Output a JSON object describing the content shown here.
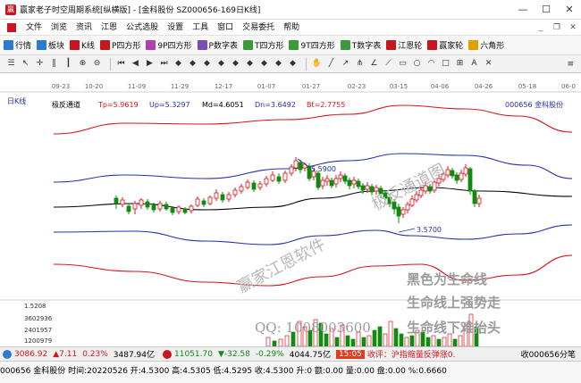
{
  "window": {
    "title": "赢家老子时空周期系统[纵横版] - [金科股份  SZ000656-169日K线]"
  },
  "menu": {
    "items": [
      "文件",
      "浏览",
      "资讯",
      "江恩",
      "公式选股",
      "设置",
      "工具",
      "窗口",
      "交易委托",
      "帮助"
    ]
  },
  "toolbar1": {
    "items": [
      {
        "label": "行情",
        "color": "#2a7ad2"
      },
      {
        "label": "板块",
        "color": "#2a7ad2"
      },
      {
        "label": "K线",
        "color": "#c8161d"
      },
      {
        "label": "P四方形",
        "color": "#c8161d"
      },
      {
        "label": "9P四方形",
        "color": "#b040b0"
      },
      {
        "label": "P数字表",
        "color": "#7a4fb5"
      },
      {
        "label": "T四方形",
        "color": "#3b9a3b"
      },
      {
        "label": "9T四方形",
        "color": "#3b9a3b"
      },
      {
        "label": "T数字表",
        "color": "#3b9a3b"
      },
      {
        "label": "江恩轮",
        "color": "#c8161d"
      },
      {
        "label": "赢家轮",
        "color": "#c8161d"
      },
      {
        "label": "六角形",
        "color": "#e0a000"
      }
    ]
  },
  "toolbar2": {
    "right_icon": "≡"
  },
  "chart": {
    "period": "日K线",
    "indicator_name": "极反通道",
    "tp_label": "Tp=5.9619",
    "up_label": "Up=5.3297",
    "md_label": "Md=4.6051",
    "dn_label": "Dn=3.6492",
    "bt_label": "Bt=2.7755",
    "stock_label": "000656 金科股份",
    "dates": [
      "09-23",
      "10-20",
      "11-09",
      "11-29",
      "12-17",
      "01-07",
      "01-27",
      "02-23",
      "03-15",
      "04-06",
      "04-26",
      "05-18",
      "06-0"
    ],
    "high_label": "5.5900",
    "low_label": "3.5700",
    "vol_ticks": [
      "1.5208",
      "3602936",
      "2401957",
      "1200979"
    ],
    "watermark1": "赢家江恩软件",
    "watermark2": "极反通道图",
    "slogan1": "黑色为生命线",
    "slogan2": "生命线上强势走",
    "slogan3": "生命线下难抬头",
    "qq": "QQ: 1008003600"
  },
  "status1": {
    "sh_index": "3086.92",
    "sh_change": "▲7.11",
    "sh_pct": "0.23%",
    "sh_amount": "3487.94亿",
    "sz_index": "11051.70",
    "sz_change": "▼-32.58",
    "sz_pct": "-0.29%",
    "sz_amount": "4044.75亿",
    "time_badge": "15:05",
    "news": "收评：沪指缩量反弹涨0.",
    "alert": "收000656分笔"
  },
  "status2": {
    "text": "000656 金科股份 时间:20220526 开:4.5300 高:4.5305 低:4.5295 收:4.5300 升:0 额:0.00 量:0.00 盘:0.00 %:0.6660"
  },
  "colors": {
    "red_band": "#d4141c",
    "blue_band": "#2430a8",
    "mid_line": "#000000",
    "up_candle": "#d4141c",
    "down_candle": "#108a10"
  }
}
